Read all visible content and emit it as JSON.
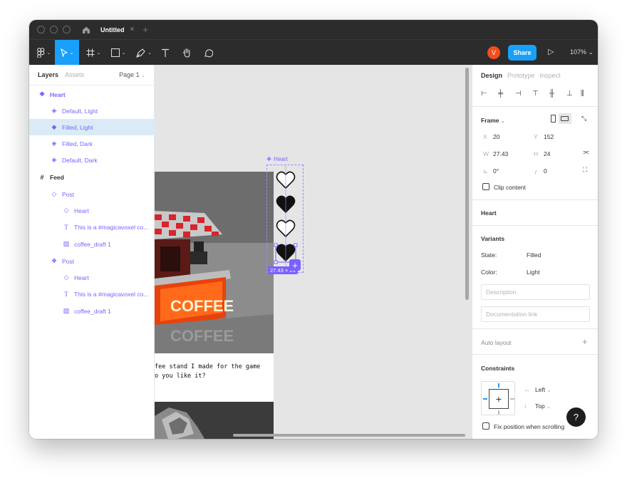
{
  "window": {
    "tab_title": "Untitled",
    "tab_close": "×",
    "tab_add": "+"
  },
  "toolbar": {
    "avatar_letter": "V",
    "share_label": "Share",
    "play_icon": "▷",
    "zoom": "107%",
    "icons": [
      "figma-menu-icon",
      "move-icon",
      "frame-icon",
      "rectangle-icon",
      "pen-icon",
      "text-icon",
      "hand-icon",
      "comment-icon"
    ],
    "accent": "#18a0fb"
  },
  "left_panel": {
    "tabs": [
      "Layers",
      "Assets"
    ],
    "page": "Page 1",
    "layers": [
      {
        "label": "Heart",
        "icon": "component-set-icon"
      },
      {
        "label": "Default, Light",
        "icon": "variant-icon"
      },
      {
        "label": "Filled, Light",
        "icon": "variant-icon",
        "selected": true
      },
      {
        "label": "Filled, Dark",
        "icon": "variant-icon"
      },
      {
        "label": "Default, Dark",
        "icon": "variant-icon"
      },
      {
        "label": "Feed",
        "icon": "frame-icon"
      },
      {
        "label": "Post",
        "icon": "instance-icon"
      },
      {
        "label": "Heart",
        "icon": "instance-icon"
      },
      {
        "label": "This is a #magicavoxel co...",
        "icon": "text-icon"
      },
      {
        "label": "coffee_draft 1",
        "icon": "image-icon"
      },
      {
        "label": "Post",
        "icon": "component-icon"
      },
      {
        "label": "Heart",
        "icon": "instance-icon"
      },
      {
        "label": "This is a #magicavoxel co...",
        "icon": "text-icon"
      },
      {
        "label": "coffee_draft 1",
        "icon": "image-icon"
      }
    ],
    "component_color": "#7b61ff",
    "selection_color": "#daebf7"
  },
  "canvas": {
    "heart_label": "Heart",
    "sign_text": "COFFEE",
    "caption": "fee stand I made for the game\no you like it?",
    "dimension_badge": "27.43 × 24",
    "add_icon": "+"
  },
  "right_panel": {
    "tabs": [
      "Design",
      "Prototype",
      "Inspect"
    ],
    "frame": {
      "title": "Frame",
      "x_label": "X",
      "x": "20",
      "y_label": "Y",
      "y": "152",
      "w_label": "W",
      "w": "27.43",
      "h_label": "H",
      "h": "24",
      "rotation": "0°",
      "radius": "0",
      "clip_content": "Clip content"
    },
    "component_name": "Heart",
    "variants": {
      "title": "Variants",
      "state_label": "State:",
      "state_value": "Filled",
      "color_label": "Color:",
      "color_value": "Light"
    },
    "description_placeholder": "Description",
    "documentation_placeholder": "Documentation link",
    "auto_layout": "Auto layout",
    "auto_layout_add": "+",
    "constraints": {
      "title": "Constraints",
      "horizontal": "Left",
      "vertical": "Top",
      "fix_position": "Fix position when scrolling"
    }
  },
  "help_label": "?"
}
